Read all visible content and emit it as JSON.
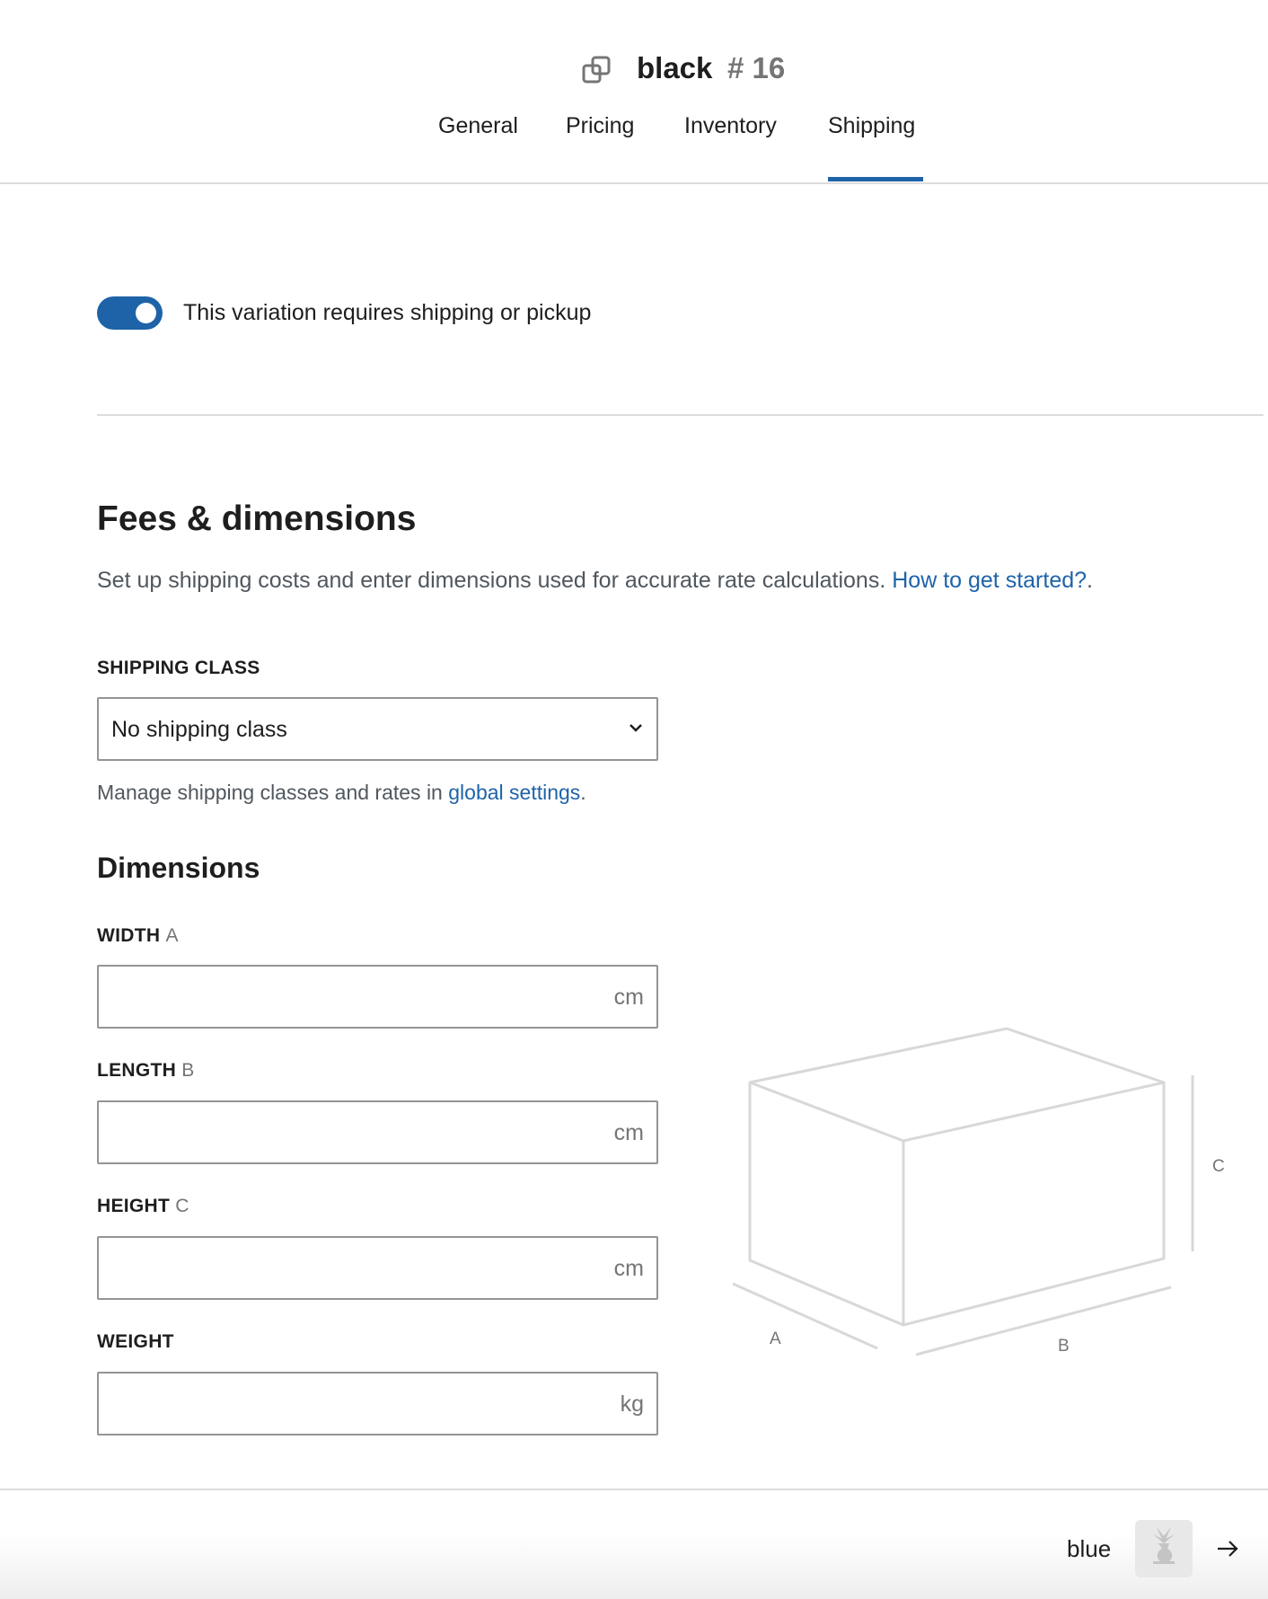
{
  "header": {
    "title": "black",
    "number": "# 16",
    "icon": "variation-copy-icon"
  },
  "tabs": [
    {
      "label": "General"
    },
    {
      "label": "Pricing"
    },
    {
      "label": "Inventory"
    },
    {
      "label": "Shipping",
      "active": true
    }
  ],
  "toggle": {
    "label": "This variation requires shipping or pickup",
    "checked": true
  },
  "fees": {
    "heading": "Fees & dimensions",
    "description": "Set up shipping costs and enter dimensions used for accurate rate calculations.",
    "link": "How to get started?",
    "shipping_class": {
      "label": "SHIPPING CLASS",
      "value": "No shipping class",
      "help": "Manage shipping classes and rates in",
      "help_link": "global settings"
    }
  },
  "dimensions": {
    "heading": "Dimensions",
    "fields": [
      {
        "label": "WIDTH",
        "letter": "A",
        "value": "",
        "unit": "cm"
      },
      {
        "label": "LENGTH",
        "letter": "B",
        "value": "",
        "unit": "cm"
      },
      {
        "label": "HEIGHT",
        "letter": "C",
        "value": "",
        "unit": "cm"
      },
      {
        "label": "WEIGHT",
        "letter": "",
        "value": "",
        "unit": "kg"
      }
    ],
    "diagram_labels": {
      "a": "A",
      "b": "B",
      "c": "C"
    }
  },
  "footer": {
    "next_label": "blue",
    "next_icon": "arrow-right-icon"
  },
  "colors": {
    "accent": "#1e63a8",
    "border": "#949494"
  }
}
